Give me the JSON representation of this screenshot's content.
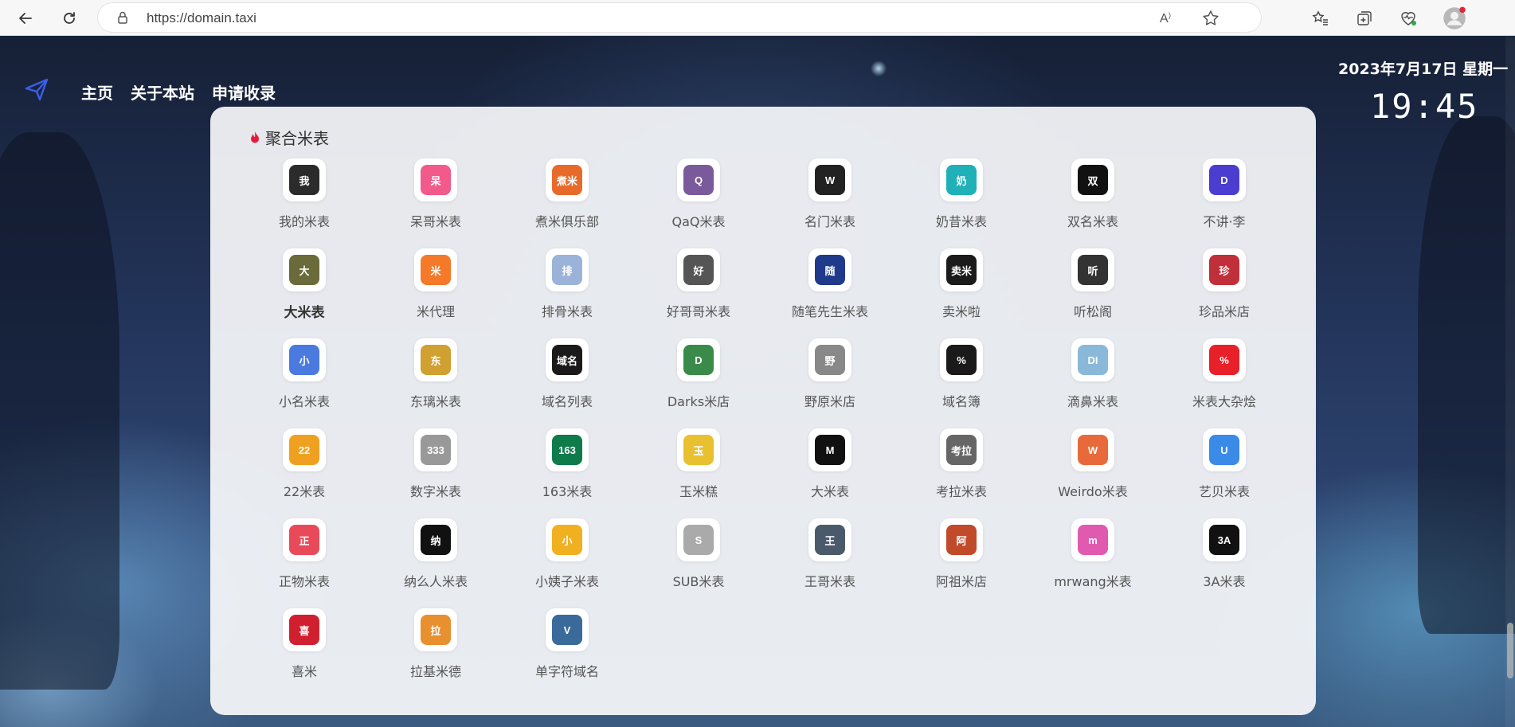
{
  "browser": {
    "url": "https://domain.taxi",
    "back_icon": "back-arrow-icon",
    "reload_icon": "reload-icon"
  },
  "nav": {
    "home": "主页",
    "about": "关于本站",
    "apply": "申请收录"
  },
  "datetime": {
    "date": "2023年7月17日 星期一",
    "time": "19:45"
  },
  "section": {
    "title": "聚合米表",
    "flame_color": "#e8193c"
  },
  "sites": [
    {
      "name": "我的米表",
      "icon": "我",
      "color": "#2b2b2b"
    },
    {
      "name": "呆哥米表",
      "icon": "呆",
      "color": "#f25a8c"
    },
    {
      "name": "煮米俱乐部",
      "icon": "煮米",
      "color": "#e86a2a"
    },
    {
      "name": "QaQ米表",
      "icon": "Q",
      "color": "#7a5a9a"
    },
    {
      "name": "名门米表",
      "icon": "W",
      "color": "#222222"
    },
    {
      "name": "奶昔米表",
      "icon": "奶",
      "color": "#1fb0b8"
    },
    {
      "name": "双名米表",
      "icon": "双",
      "color": "#111111"
    },
    {
      "name": "不讲·李",
      "icon": "D",
      "color": "#4a3dd0"
    },
    {
      "name": "大米表",
      "icon": "大",
      "color": "#6b6a3a"
    },
    {
      "name": "米代理",
      "icon": "米",
      "color": "#f47a2a"
    },
    {
      "name": "排骨米表",
      "icon": "排",
      "color": "#9bb3d8"
    },
    {
      "name": "好哥哥米表",
      "icon": "好",
      "color": "#555555"
    },
    {
      "name": "随笔先生米表",
      "icon": "随",
      "color": "#1f3a8a"
    },
    {
      "name": "卖米啦",
      "icon": "卖米",
      "color": "#1b1b1b"
    },
    {
      "name": "听松阁",
      "icon": "听",
      "color": "#333333"
    },
    {
      "name": "珍品米店",
      "icon": "珍",
      "color": "#c0303a"
    },
    {
      "name": "小名米表",
      "icon": "小",
      "color": "#4a7ae0"
    },
    {
      "name": "东璃米表",
      "icon": "东",
      "color": "#d0a030"
    },
    {
      "name": "域名列表",
      "icon": "域名",
      "color": "#1a1a1a"
    },
    {
      "name": "Darks米店",
      "icon": "D",
      "color": "#3a8a4a"
    },
    {
      "name": "野原米店",
      "icon": "野",
      "color": "#888888"
    },
    {
      "name": "域名簿",
      "icon": "%",
      "color": "#1a1a1a"
    },
    {
      "name": "滴鼻米表",
      "icon": "DI",
      "color": "#8ab8d8"
    },
    {
      "name": "米表大杂烩",
      "icon": "%",
      "color": "#e8202a"
    },
    {
      "name": "22米表",
      "icon": "22",
      "color": "#f0a020"
    },
    {
      "name": "数字米表",
      "icon": "333",
      "color": "#999999"
    },
    {
      "name": "163米表",
      "icon": "163",
      "color": "#0f7a4a"
    },
    {
      "name": "玉米糕",
      "icon": "玉",
      "color": "#e8c030"
    },
    {
      "name": "大米表",
      "icon": "M",
      "color": "#111111"
    },
    {
      "name": "考拉米表",
      "icon": "考拉",
      "color": "#666666"
    },
    {
      "name": "Weirdo米表",
      "icon": "W",
      "color": "#e86a3a"
    },
    {
      "name": "艺贝米表",
      "icon": "U",
      "color": "#3a8ae8"
    },
    {
      "name": "正物米表",
      "icon": "正",
      "color": "#e84a5a"
    },
    {
      "name": "纳么人米表",
      "icon": "纳",
      "color": "#111111"
    },
    {
      "name": "小姨子米表",
      "icon": "小",
      "color": "#f0b020"
    },
    {
      "name": "SUB米表",
      "icon": "S",
      "color": "#aaaaaa"
    },
    {
      "name": "王哥米表",
      "icon": "王",
      "color": "#4a5a6a"
    },
    {
      "name": "阿祖米店",
      "icon": "阿",
      "color": "#c04a2a"
    },
    {
      "name": "mrwang米表",
      "icon": "m",
      "color": "#e05ab0"
    },
    {
      "name": "3A米表",
      "icon": "3A",
      "color": "#111111"
    },
    {
      "name": "喜米",
      "icon": "喜",
      "color": "#d02030"
    },
    {
      "name": "拉基米德",
      "icon": "拉",
      "color": "#e89030"
    },
    {
      "name": "单字符域名",
      "icon": "V",
      "color": "#3a6a9a"
    }
  ]
}
